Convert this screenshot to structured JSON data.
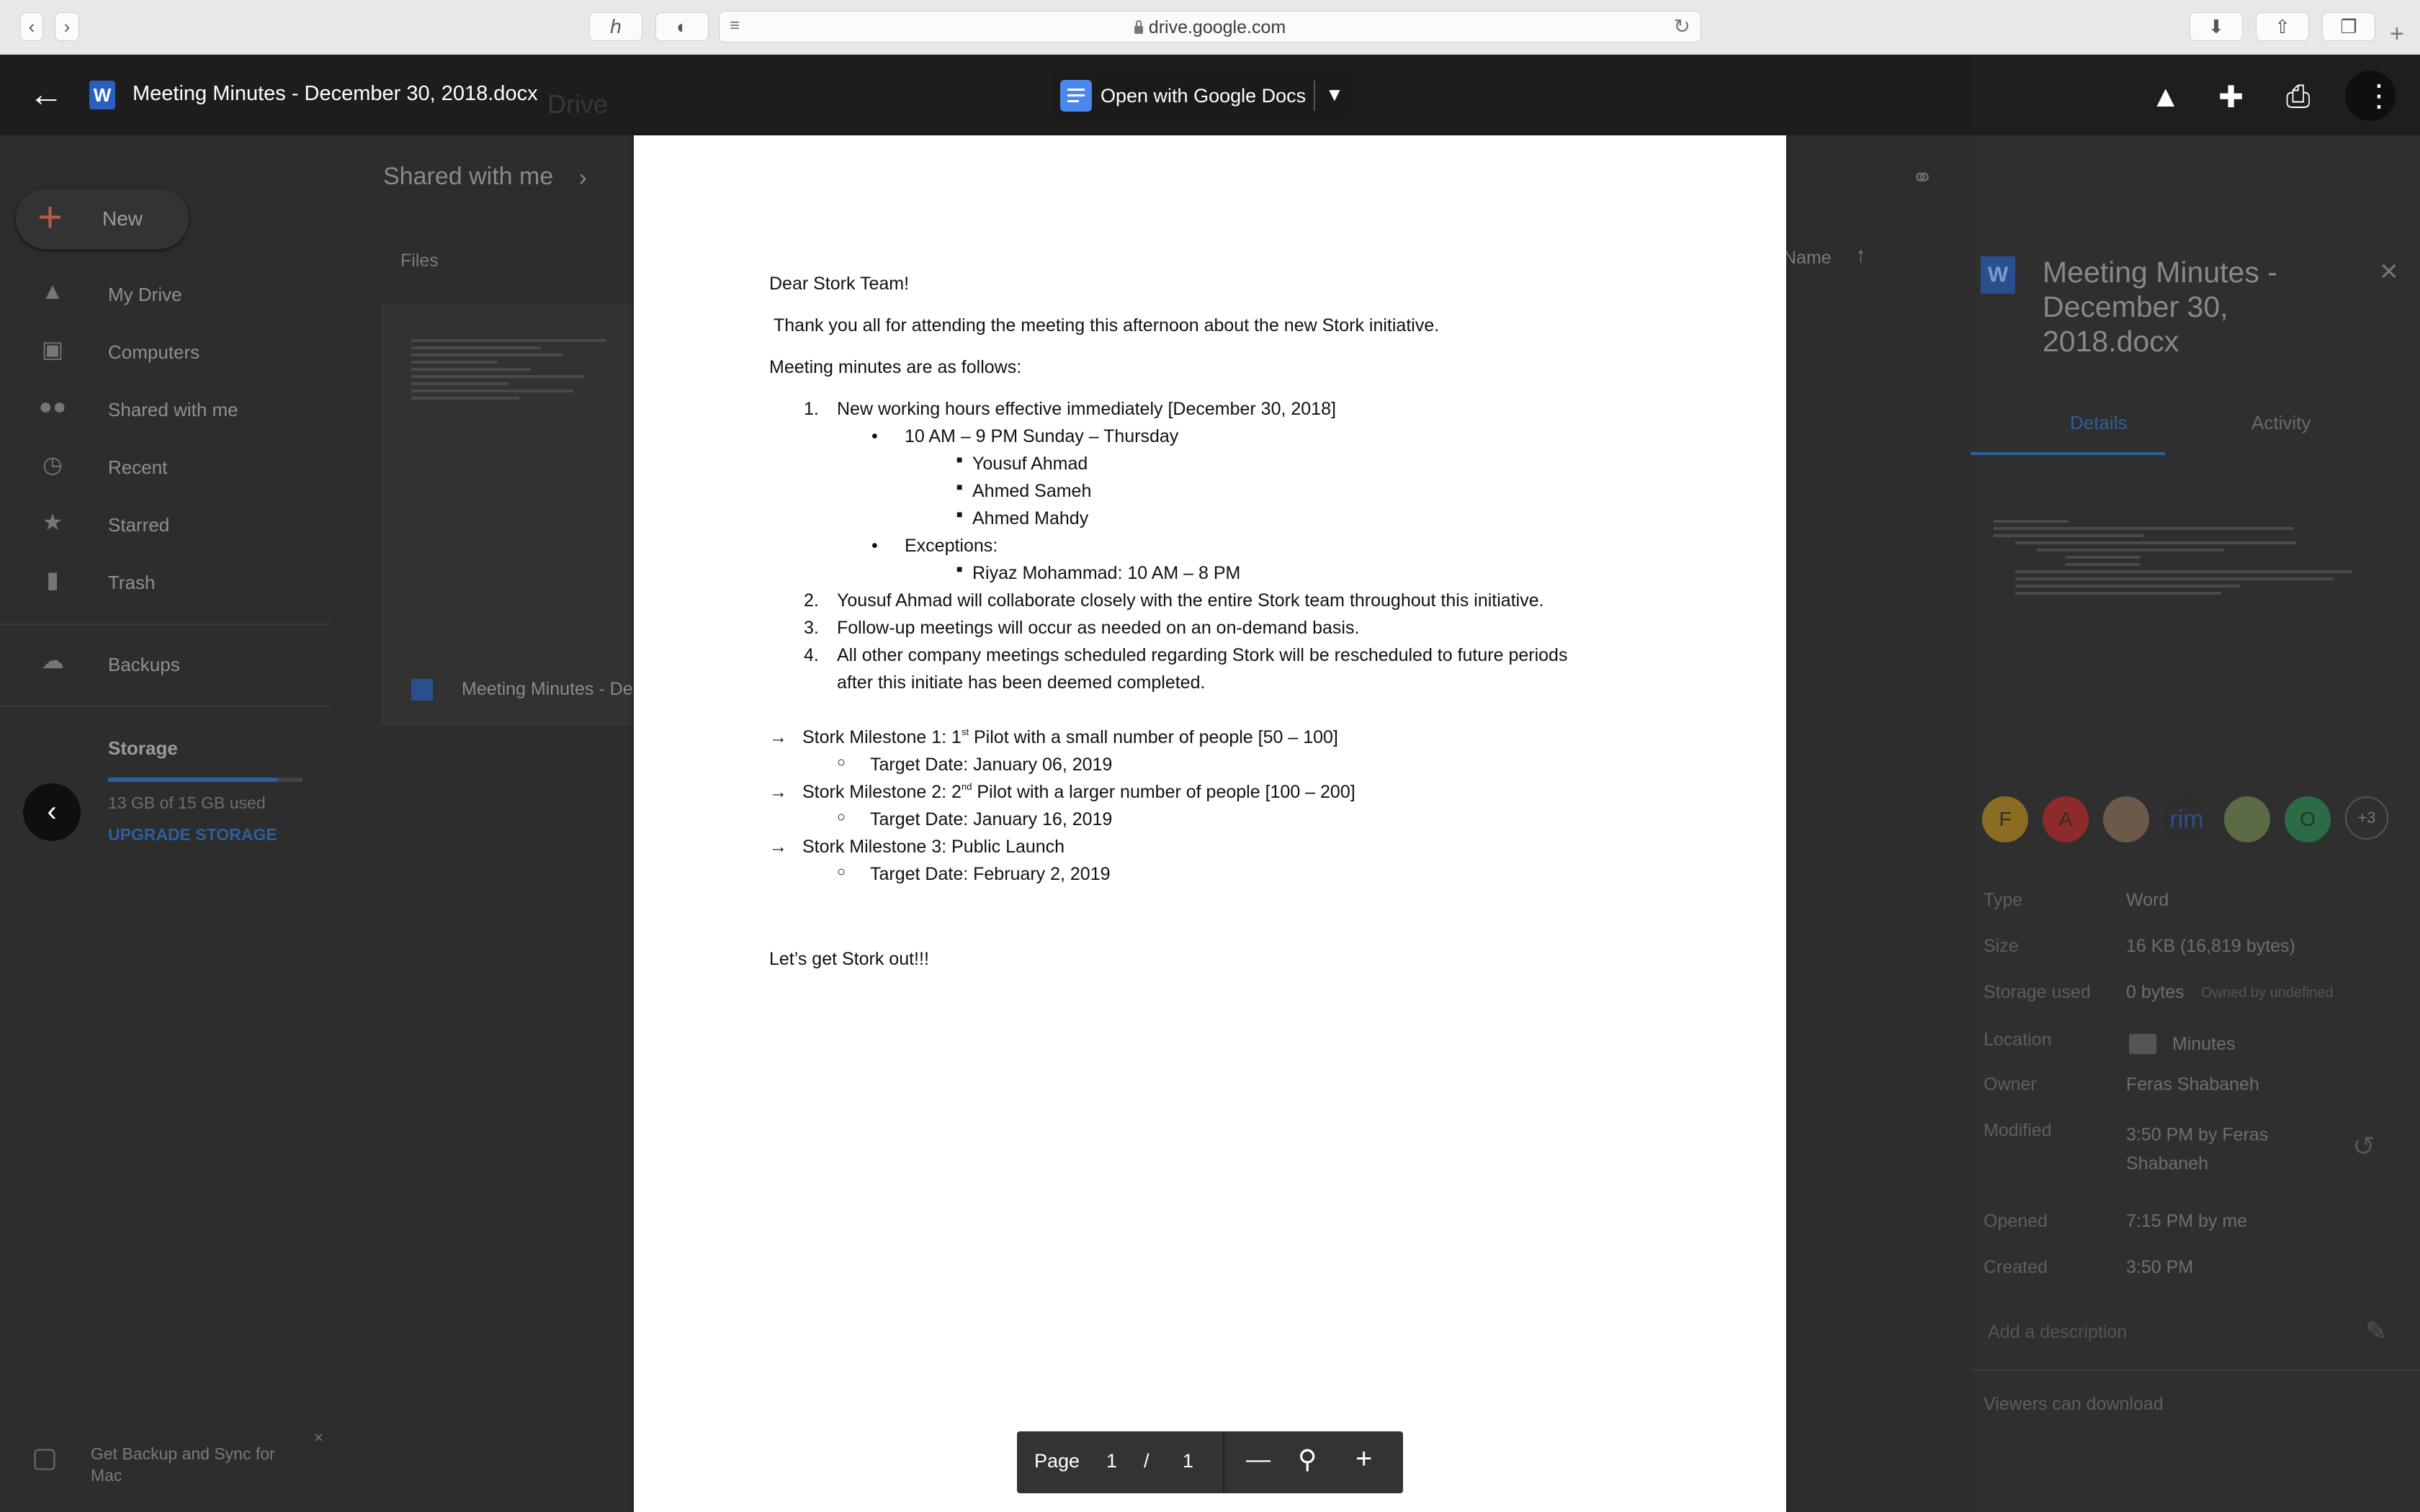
{
  "browser": {
    "url": "drive.google.com"
  },
  "drive": {
    "new_label": "New",
    "header_title_partial": "Drive",
    "breadcrumb": "Shared with me",
    "files_heading": "Files",
    "sort_label": "Name",
    "sidebar": [
      {
        "label": "My Drive"
      },
      {
        "label": "Computers"
      },
      {
        "label": "Shared with me"
      },
      {
        "label": "Recent"
      },
      {
        "label": "Starred"
      },
      {
        "label": "Trash"
      },
      {
        "label": "Backups"
      }
    ],
    "storage": {
      "title": "Storage",
      "used": "13 GB of 15 GB used",
      "upgrade": "UPGRADE STORAGE",
      "used_fraction": 0.87
    },
    "file_card_name": "Meeting Minutes - De",
    "backup_promo": "Get Backup and Sync for Mac"
  },
  "details": {
    "title": "Meeting Minutes - December 30, 2018.docx",
    "tabs": [
      "Details",
      "Activity"
    ],
    "avatars": [
      {
        "text": "F",
        "color": "#8a6d22"
      },
      {
        "text": "A",
        "color": "#8d2a2a"
      },
      {
        "text": "",
        "color": "#6b5a4a"
      },
      {
        "text": "rim",
        "color": "#2e2e2e"
      },
      {
        "text": "",
        "color": "#5a6b45"
      },
      {
        "text": "O",
        "color": "#2b6b45"
      },
      {
        "text": "+3",
        "color": "#3a3a3a"
      }
    ],
    "fields": [
      {
        "label": "Type",
        "value": "Word"
      },
      {
        "label": "Size",
        "value": "16 KB (16,819 bytes)"
      },
      {
        "label": "Storage used",
        "value": "0 bytes",
        "extra": "Owned by undefined"
      },
      {
        "label": "Location",
        "value": "Minutes"
      },
      {
        "label": "Owner",
        "value": "Feras Shabaneh"
      },
      {
        "label": "Modified",
        "value": "3:50 PM by Feras Shabaneh"
      },
      {
        "label": "Opened",
        "value": "7:15 PM by me"
      },
      {
        "label": "Created",
        "value": "3:50 PM"
      }
    ],
    "description_placeholder": "Add a description",
    "viewers_note": "Viewers can download"
  },
  "viewer": {
    "title": "Meeting Minutes - December 30, 2018.docx",
    "open_with": "Open with Google Docs"
  },
  "document": {
    "greeting": "Dear Stork Team!",
    "intro": "Thank you all for attending the meeting this afternoon about the new Stork initiative.",
    "minutes_heading": "Meeting minutes are as follows:",
    "item1": "New working hours effective immediately [December 30, 2018]",
    "hours": "10 AM – 9 PM Sunday – Thursday",
    "people": [
      "Yousuf Ahmad",
      "Ahmed Sameh",
      "Ahmed Mahdy"
    ],
    "exceptions_label": "Exceptions:",
    "exception_person": "Riyaz Mohammad: 10 AM – 8 PM",
    "item2": "Yousuf Ahmad will collaborate closely with the entire Stork team throughout this initiative.",
    "item3": "Follow-up meetings will occur as needed on an on-demand basis.",
    "item4_line1": "All other company meetings scheduled regarding Stork will be rescheduled to future periods",
    "item4_line2": "after this initiate has been deemed completed.",
    "m1_a": "Stork Milestone 1: 1",
    "m1_sup": "st",
    "m1_b": " Pilot with a small number of people [50 – 100]",
    "m1_date": "Target Date: January 06, 2019",
    "m2_a": "Stork Milestone 2: 2",
    "m2_sup": "nd",
    "m2_b": " Pilot with a larger number of people [100 – 200]",
    "m2_date": "Target Date: January 16, 2019",
    "m3": "Stork Milestone 3: Public Launch",
    "m3_date": "Target Date: February 2, 2019",
    "closing": "Let’s get Stork out!!!"
  },
  "pager": {
    "page_label": "Page",
    "current": "1",
    "slash": "/",
    "total": "1"
  }
}
